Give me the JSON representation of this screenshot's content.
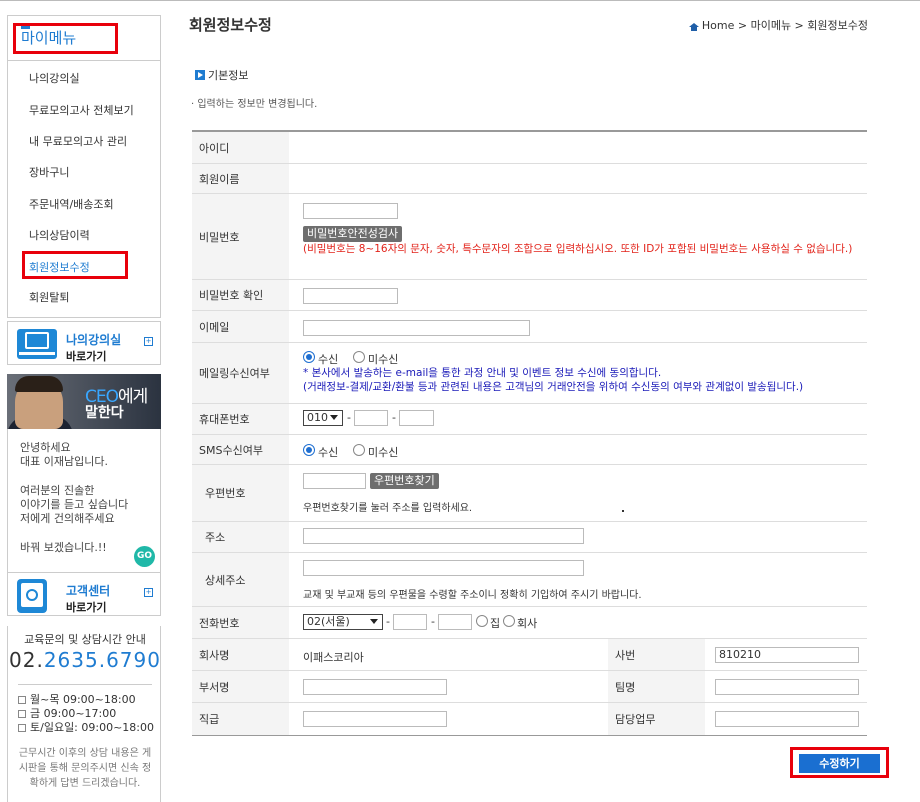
{
  "sidebar": {
    "title": "마이메뉴",
    "items": [
      {
        "label": "나의강의실"
      },
      {
        "label": "무료모의고사 전체보기"
      },
      {
        "label": "내 무료모의고사 관리"
      },
      {
        "label": "장바구니"
      },
      {
        "label": "주문내역/배송조회"
      },
      {
        "label": "나의상담이력"
      },
      {
        "label": "회원정보수정",
        "active": true
      },
      {
        "label": "회원탈퇴"
      }
    ],
    "classroom_link": {
      "title": "나의강의실",
      "subtitle": "바로가기"
    },
    "ceo": {
      "banner_prefix": "CEO",
      "banner_suffix": "에게",
      "banner_line2": "말한다",
      "msg1": "안녕하세요",
      "msg2": "대표 이재남입니다.",
      "msg3": "여러분의 진솔한",
      "msg4": "이야기를 듣고 싶습니다",
      "msg5": "저에게 건의해주세요",
      "msg6": "바꿔 보겠습니다.!!",
      "go_label": "GO"
    },
    "cs_link": {
      "title": "고객센터",
      "subtitle": "바로가기"
    },
    "hours": {
      "title": "교육문의 및 상담시간 안내",
      "phone_prefix": "02.",
      "phone_number": "2635.6790",
      "row1": "월~목 09:00~18:00",
      "row2": "금 09:00~17:00",
      "row3": "토/일요일: 09:00~18:00",
      "note": "근무시간 이후의 상담 내용은 게시판을 통해 문의주시면 신속 정확하게 답변 드리겠습니다."
    }
  },
  "page": {
    "title": "회원정보수정",
    "breadcrumb": "Home > 마이메뉴 > 회원정보수정",
    "section_title": "기본정보",
    "section_desc": "· 입력하는 정보만 변경됩니다."
  },
  "form": {
    "id_label": "아이디",
    "name_label": "회원이름",
    "pw_label": "비밀번호",
    "pw_check_button": "비밀번호안전성검사",
    "pw_rule": "(비밀번호는 8~16자의 문자, 숫자, 특수문자의 조합으로 입력하십시오. 또한 ID가 포함된 비밀번호는 사용하실 수 없습니다.)",
    "pw_confirm_label": "비밀번호 확인",
    "email_label": "이메일",
    "mailing_label": "메일링수신여부",
    "opt_receive": "수신",
    "opt_no_receive": "미수신",
    "mailing_note1": "* 본사에서 발송하는 e-mail을 통한 과정 안내 및 이벤트 정보 수신에 동의합니다.",
    "mailing_note2": "(거래정보-결제/교환/환불 등과 관련된 내용은 고객님의 거래안전을 위하여 수신동의 여부와 관계없이 발송됩니다.)",
    "mobile_label": "휴대폰번호",
    "mobile_prefix": "010",
    "sms_label": "SMS수신여부",
    "zip_label": "우편번호",
    "zip_button": "우편번호찾기",
    "zip_note": "우편번호찾기를 눌러 주소를 입력하세요.",
    "addr_label": "주소",
    "addr_detail_label": "상세주소",
    "addr_note": "교재 및 부교재 등의 우편물을 수령할 주소이니 정확히 기입하여 주시기 바랍니다.",
    "tel_label": "전화번호",
    "tel_area": "02(서울)",
    "opt_home": "집",
    "opt_company": "회사",
    "company_label": "회사명",
    "company_value": "이패스코리아",
    "empno_label": "사번",
    "empno_value": "810210",
    "dept_label": "부서명",
    "team_label": "팀명",
    "rank_label": "직급",
    "duty_label": "담당업무",
    "submit": "수정하기"
  },
  "colors": {
    "accent": "#1f7cd1",
    "highlight_border": "#e8000b",
    "warning": "#e2231a"
  }
}
